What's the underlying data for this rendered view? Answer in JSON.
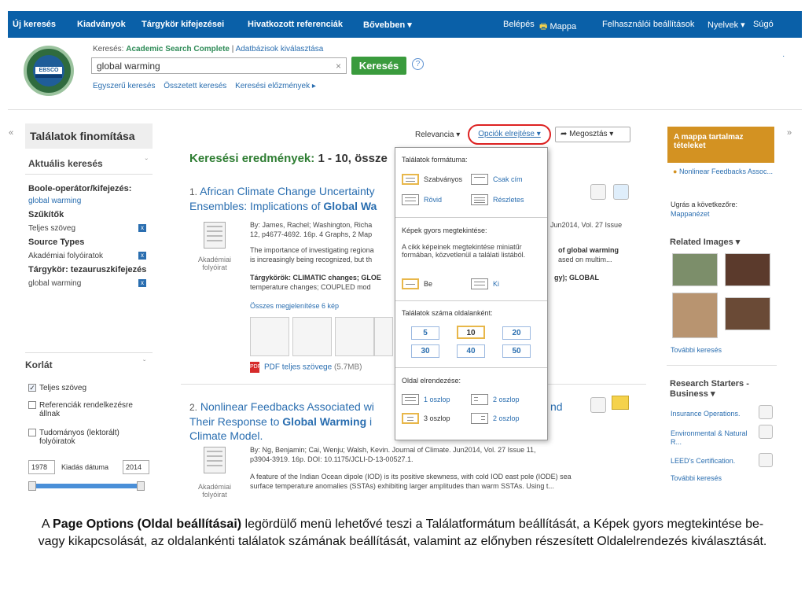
{
  "topnav": {
    "left": [
      "Új keresés",
      "Kiadványok",
      "Tárgykör kifejezései",
      "Hivatkozott referenciák",
      "Bővebben ▾"
    ],
    "right": [
      "Belépés",
      "Mappa",
      "Felhasználói beállítások",
      "Nyelvek ▾",
      "Súgó"
    ]
  },
  "search": {
    "label_prefix": "Keresés: ",
    "database": "Academic Search Complete",
    "db_select": "Adatbázisok kiválasztása",
    "query": "global warming",
    "clear": "×",
    "button": "Keresés",
    "help": "?",
    "links": [
      "Egyszerű keresés",
      "Összetett keresés",
      "Keresési előzmények ▸"
    ],
    "logo_text": "EBSCO"
  },
  "left": {
    "title": "Találatok finomítása",
    "current": "Aktuális keresés",
    "boolean_label": "Boole-operátor/kifejezés:",
    "boolean_value": "global warming",
    "limiters": "Szűkítők",
    "fulltext": "Teljes szöveg",
    "source_types": "Source Types",
    "academic": "Akadémiai folyóiratok",
    "subject_label": "Tárgykör: tezauruszkifejezés",
    "subject_value": "global warming",
    "x": "x",
    "korlat": "Korlát",
    "checks": [
      "Teljes szöveg",
      "Referenciák rendelkezésre állnak",
      "Tudományos (lektorált) folyóiratok"
    ],
    "date_from": "1978",
    "date_label": "Kiadás dátuma",
    "date_to": "2014"
  },
  "toolbar": {
    "relevance": "Relevancia ▾",
    "options": "Opciók elrejtése ▾",
    "share": "Megosztás ▾"
  },
  "results": {
    "heading": "Keresési eredmények: ",
    "range": "1 - 10, össze",
    "r1": {
      "num": "1.",
      "title1": "African Climate Change Uncertainty",
      "title2a": "Ensembles: Implications of ",
      "title2b": "Global Wa",
      "meta1": "By: James, Rachel; Washington, Richa",
      "meta1b": "Jun2014, Vol. 27 Issue",
      "meta2": "12, p4677-4692. 16p. 4 Graphs, 2 Map",
      "abs1": "The importance of investigating regiona",
      "abs1b": "of global warming",
      "abs2": "is increasingly being recognized, but th",
      "abs2b": "ased on multim...",
      "subj1": "Tárgykörök: CLIMATIC changes; GLOE",
      "subj1b": "gy); GLOBAL",
      "subj2": "temperature changes; COUPLED mod",
      "allimg": "Összes megjelenítése 6 kép",
      "pdf": "PDF teljes szövege",
      "pdf_size": "(5.7MB)",
      "type": "Akadémiai folyóirat"
    },
    "r2": {
      "num": "2.",
      "title1": "Nonlinear Feedbacks Associated wi",
      "title1b": "nd",
      "title2a": "Their Response to ",
      "title2b": "Global Warming",
      "title2c": " i",
      "title3": "Climate Model.",
      "meta1": "By: Ng, Benjamin; Cai, Wenju; Walsh, Kevin. Journal of Climate. Jun2014, Vol. 27 Issue 11,",
      "meta2": "p3904-3919. 16p. DOI: 10.1175/JCLI-D-13-00527.1.",
      "abs1": "A feature of the Indian Ocean dipole (IOD) is its positive skewness, with cold IOD east pole (IODE) sea",
      "abs2": "surface temperature anomalies (SSTAs) exhibiting larger amplitudes than warm SSTAs. Using t...",
      "type": "Akadémiai folyóirat"
    }
  },
  "dropdown": {
    "format_head": "Találatok formátuma:",
    "standard": "Szabványos",
    "title_only": "Csak cím",
    "brief": "Rövid",
    "detailed": "Részletes",
    "images_head": "Képek gyors megtekintése:",
    "images_desc": "A cikk képeinek megtekintése miniatűr formában, közvetlenül a találati listából.",
    "on": "Be",
    "off": "Ki",
    "perpage_head": "Találatok száma oldalanként:",
    "perpage": [
      "5",
      "10",
      "20",
      "30",
      "40",
      "50"
    ],
    "perpage_selected": "10",
    "layout_head": "Oldal elrendezése:",
    "col1": "1 oszlop",
    "col2a": "2 oszlop",
    "col3": "3 oszlop",
    "col2b": "2 oszlop"
  },
  "right": {
    "mappa": "A mappa tartalmaz tételeket",
    "item": "Nonlinear Feedbacks Assoc...",
    "goto": "Ugrás a következőre:",
    "goto_link": "Mappanézet",
    "related": "Related Images ▾",
    "more1": "További keresés",
    "rs_head": "Research Starters - Business ▾",
    "rs": [
      "Insurance Operations.",
      "Environmental & Natural R...",
      "LEED's Certification."
    ],
    "more2": "További keresés"
  },
  "caption": {
    "pre": "A ",
    "bold": "Page Options (Oldal beállításai)",
    "post": " legördülő menü lehetővé teszi a Találatformátum beállítását, a Képek gyors megtekintése be- vagy kikapcsolását, az oldalankénti találatok számának beállítását, valamint az előnyben részesített Oldalelrendezés kiválasztását."
  }
}
